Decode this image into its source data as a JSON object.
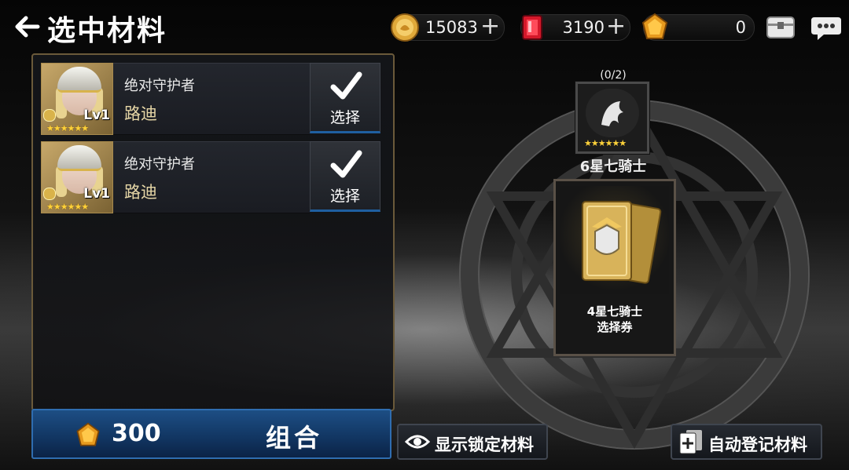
{
  "header": {
    "title": "选中材料",
    "resources": {
      "gold": "15083",
      "rubies": "3190",
      "topaz": "0"
    }
  },
  "materials": [
    {
      "title": "绝对守护者",
      "name": "路迪",
      "level": "Lv1",
      "button": "选择",
      "stars": 6
    },
    {
      "title": "绝对守护者",
      "name": "路迪",
      "level": "Lv1",
      "button": "选择",
      "stars": 6
    }
  ],
  "combine": {
    "cost": "300",
    "label": "组合"
  },
  "requirement": {
    "count": "(0/2)",
    "label": "6星七骑士",
    "stars": 6
  },
  "reward": {
    "line1": "4星七骑士",
    "line2": "选择券"
  },
  "actions": {
    "show_locked": "显示锁定材料",
    "auto_register": "自动登记材料"
  },
  "colors": {
    "accent_blue": "#1d4e84",
    "star_gold": "#ffd23a",
    "panel_border": "#6b5a3a"
  }
}
